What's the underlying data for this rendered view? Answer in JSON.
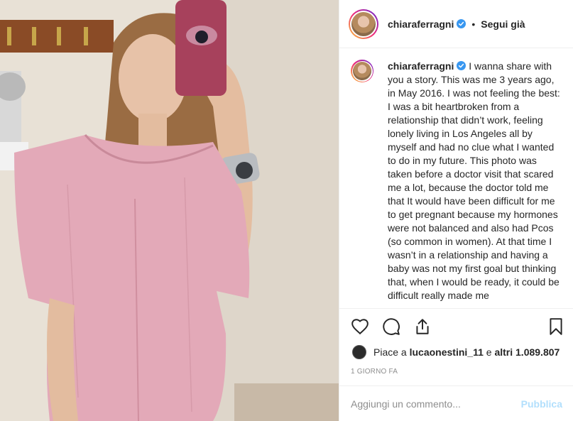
{
  "post": {
    "username": "chiaraferragni",
    "follow_label": "Segui già",
    "dot": "•",
    "caption": "I wanna share with you a story. This was me 3 years ago, in May 2016. I was not feeling the best: I was a bit heartbroken from a relationship that didn’t work, feeling lonely living in Los Angeles all by myself and had no clue what I wanted to do in my future. This photo was taken before a doctor visit that scared me a lot, because the doctor told me that It would have been difficult for me to get pregnant because my hormones were not balanced and also had Pcos (so common in women). At that time I wasn’t in a relationship and having a baby was not my first goal but thinking that, when I would be ready, it could be difficult really made me",
    "likes_prefix": "Piace a",
    "likes_user": "lucaonestini_11",
    "likes_joiner": "e",
    "likes_others": "altri 1.089.807",
    "time_ago": "1 GIORNO FA"
  },
  "comment": {
    "placeholder": "Aggiungi un commento...",
    "publish_label": "Pubblica"
  },
  "icons": {
    "like": "heart-icon",
    "comment": "comment-bubble-icon",
    "share": "share-icon",
    "save": "bookmark-icon",
    "verified": "verified-badge-icon"
  },
  "colors": {
    "text": "#262626",
    "muted": "#8e8e8e",
    "verified": "#3897f0",
    "publish_disabled": "#b2dffc",
    "border": "#efefef"
  }
}
